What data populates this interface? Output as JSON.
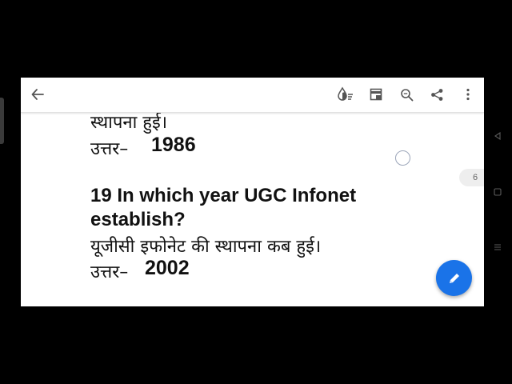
{
  "toolbar": {
    "back_icon": "arrow-left-icon",
    "actions": [
      "brightness-icon",
      "reading-mode-icon",
      "search-icon",
      "share-icon",
      "more-vert-icon"
    ]
  },
  "document": {
    "lines": [
      "स्थापना हुई।",
      "उत्तर–",
      "1986",
      "19 In which year UGC Infonet",
      "establish?",
      "यूजीसी इफोनेट की स्थापना कब हुई।",
      "उत्तर–",
      "2002"
    ]
  },
  "page_indicator": "6",
  "fab_icon": "edit-pencil-icon",
  "system_nav": [
    "back-triangle-icon",
    "home-square-icon",
    "recents-lines-icon"
  ]
}
